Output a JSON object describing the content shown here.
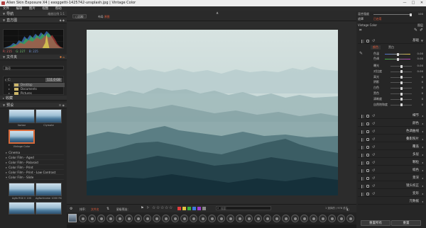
{
  "window": {
    "title": "Alien Skin Exposure X4 | exoggetti-1425742-unsplash.jpg | Vintage Color",
    "controls": [
      "—",
      "□",
      "✕"
    ]
  },
  "menu": [
    "文件",
    "编辑",
    "图片",
    "视图",
    "帮助"
  ],
  "left": {
    "nav_label": "导航",
    "nav_right": "缩放比例",
    "nav_zoom": "1:1",
    "histogram_label": "直方图",
    "histogram_values": {
      "r": "R: 215",
      "g": "G: 227",
      "b": "B: 225"
    },
    "browser_label": "文件夹",
    "path_placeholder": "路径",
    "drive": "C:",
    "drive_size": "111.0 GB",
    "tree": [
      "Desktop",
      "Documents",
      "Pictures"
    ],
    "collection_label": "收藏",
    "presets_label": "预设",
    "thumbs": [
      "Varbar",
      "Clymate",
      "Vintage Color"
    ],
    "preset_categories": [
      "Cinema",
      "Color Film - Aged",
      "Color Film - Polaroid",
      "Color Film - Print",
      "Color Film - Print - Low Contrast",
      "Color Film - Slide"
    ],
    "bottom_thumbs": [
      "Agfa RSX II 100",
      "Agfachrome 1000 RS"
    ]
  },
  "center": {
    "toolbar": {
      "compare": "□比较",
      "filter_label": "布局",
      "filter_value": "原图"
    },
    "bottom": {
      "sort_label": "排序：",
      "sort_value": "文件名",
      "view_label": "星级筛选：",
      "search_placeholder": "搜索",
      "count": "1 选择的 / 978 总共"
    },
    "colors": [
      "#e03c3c",
      "#e0c03c",
      "#3cb43c",
      "#3c78e0",
      "#a03cd0",
      "#888888"
    ]
  },
  "right": {
    "top_rows": [
      {
        "label": "混合强度",
        "value": "100"
      },
      {
        "label": "遮罩",
        "value": "已启用"
      }
    ],
    "preset_name": "Vintage Color",
    "preset_right": "图层",
    "basic_label": "基础",
    "tabs": [
      "颜色",
      "黑白"
    ],
    "sliders": [
      {
        "label": "曝光",
        "value": "0.00",
        "pos": 0.5
      },
      {
        "label": "对比度",
        "value": "0.00",
        "pos": 0.5
      },
      {
        "label": "高光",
        "value": "0",
        "pos": 0.5
      },
      {
        "label": "阴影",
        "value": "0",
        "pos": 0.5
      },
      {
        "label": "白色",
        "value": "0",
        "pos": 0.5
      },
      {
        "label": "黑色",
        "value": "0",
        "pos": 0.5
      },
      {
        "label": "清晰度",
        "value": "0",
        "pos": 0.5
      },
      {
        "label": "自然饱和度",
        "value": "0",
        "pos": 0.5
      }
    ],
    "temp_rows": [
      {
        "label": "色温",
        "value": "0.00"
      },
      {
        "label": "色调",
        "value": "0.00"
      }
    ],
    "sections": [
      "细节",
      "颜色",
      "色调曲线",
      "叠影照片",
      "覆盖",
      "多层",
      "颗粒",
      "缎色",
      "景深",
      "镜头校正",
      "变形",
      "元数据"
    ],
    "reset_all": "重置所有",
    "reset": "重置"
  }
}
